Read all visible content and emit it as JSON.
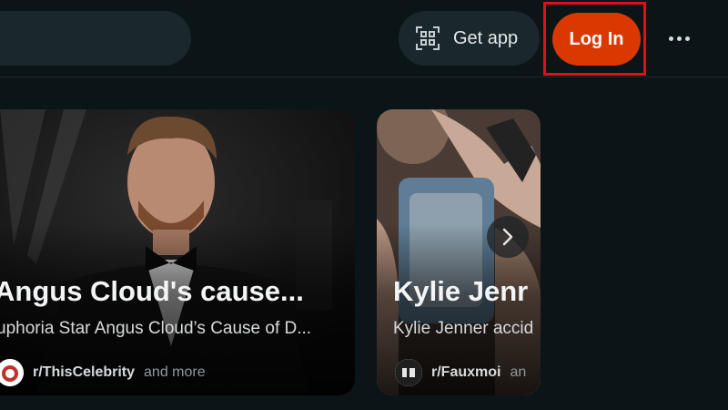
{
  "header": {
    "get_app_label": "Get app",
    "login_label": "Log In",
    "icons": {
      "qr": "qr-code-icon",
      "more": "more-options-icon"
    },
    "login_color": "#d93900"
  },
  "cards": [
    {
      "title": "Angus Cloud's cause...",
      "subtitle": "uphoria Star Angus Cloud’s Cause of D...",
      "source": "r/ThisCelebrity",
      "source_suffix": "and more"
    },
    {
      "title": "Kylie Jenr",
      "subtitle": "Kylie Jenner accid",
      "source": "r/Fauxmoi",
      "source_suffix": "an"
    }
  ],
  "carousel": {
    "next_icon": "chevron-right-icon"
  }
}
